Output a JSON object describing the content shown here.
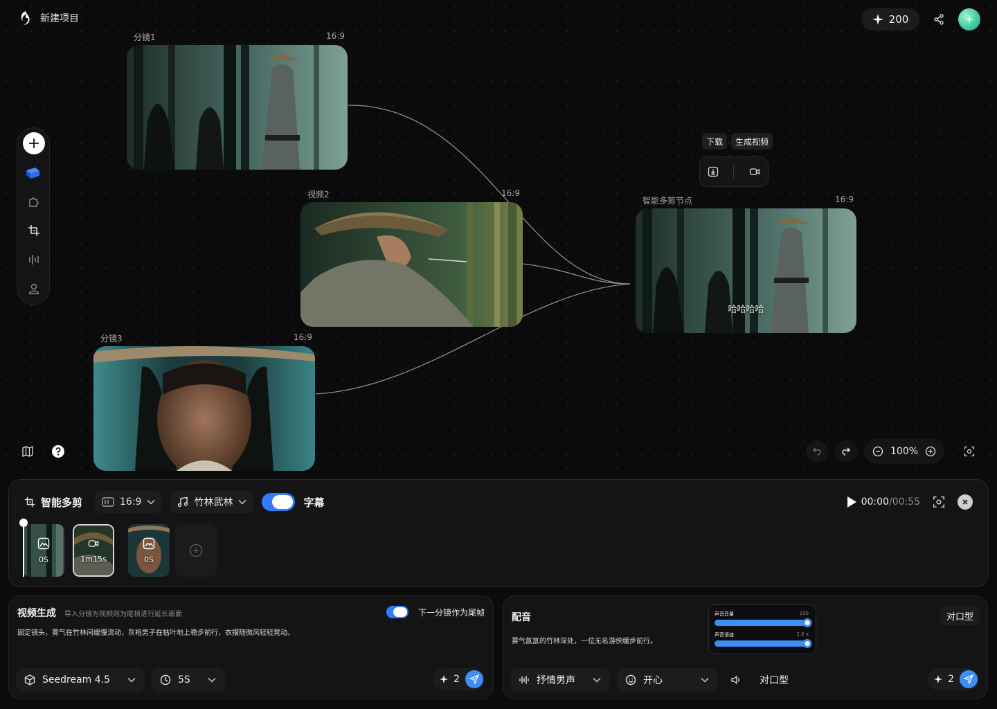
{
  "header": {
    "project_title": "新建项目",
    "credits": "200"
  },
  "nodes": [
    {
      "title": "分镜1",
      "ratio": "16:9"
    },
    {
      "title": "视频2",
      "ratio": "16:9"
    },
    {
      "title": "分镜3",
      "ratio": "16:9"
    },
    {
      "title": "智能多剪节点",
      "ratio": "16:9",
      "caption": "哈哈哈哈"
    }
  ],
  "node_actions": {
    "download_tip": "下载",
    "generate_video_tip": "生成视频"
  },
  "canvas_controls": {
    "zoom": "100%"
  },
  "timeline": {
    "title": "智能多剪",
    "ratio": "16:9",
    "music": "竹林武林",
    "subtitle_label": "字幕",
    "subtitle_on": true,
    "time_current": "00:00",
    "time_total": "/00:55",
    "clips": [
      {
        "duration": "0S",
        "kind": "image"
      },
      {
        "duration": "1m15s",
        "kind": "video"
      },
      {
        "duration": "0S",
        "kind": "image"
      }
    ]
  },
  "video_panel": {
    "title": "视频生成",
    "hint": "导入分镜为视频则为尾帧进行延长画面",
    "toggle_label": "下一分镜作为尾帧",
    "toggle_on": true,
    "prompt": "固定镜头，雾气在竹林间缓慢流动，灰袍男子在枯叶地上稳步前行，衣摆随微风轻轻晃动。",
    "model": "Seedream 4.5",
    "duration": "5S",
    "cost": "2"
  },
  "voice_panel": {
    "title": "配音",
    "text": "雾气氤氲的竹林深处，一位无名游侠缓步前行。",
    "volume_label": "声音音量",
    "volume_value": "100",
    "volume_level": 1.0,
    "speed_label": "声音语速",
    "speed_value": "2.0 x",
    "speed_level": 1.0,
    "lip_sync_button": "对口型",
    "voice": "抒情男声",
    "emotion": "开心",
    "lip_sync_label": "对口型",
    "cost": "2"
  },
  "colors": {
    "accent": "#3e8ef7",
    "background": "#0b0b0c",
    "panel": "#141416"
  }
}
